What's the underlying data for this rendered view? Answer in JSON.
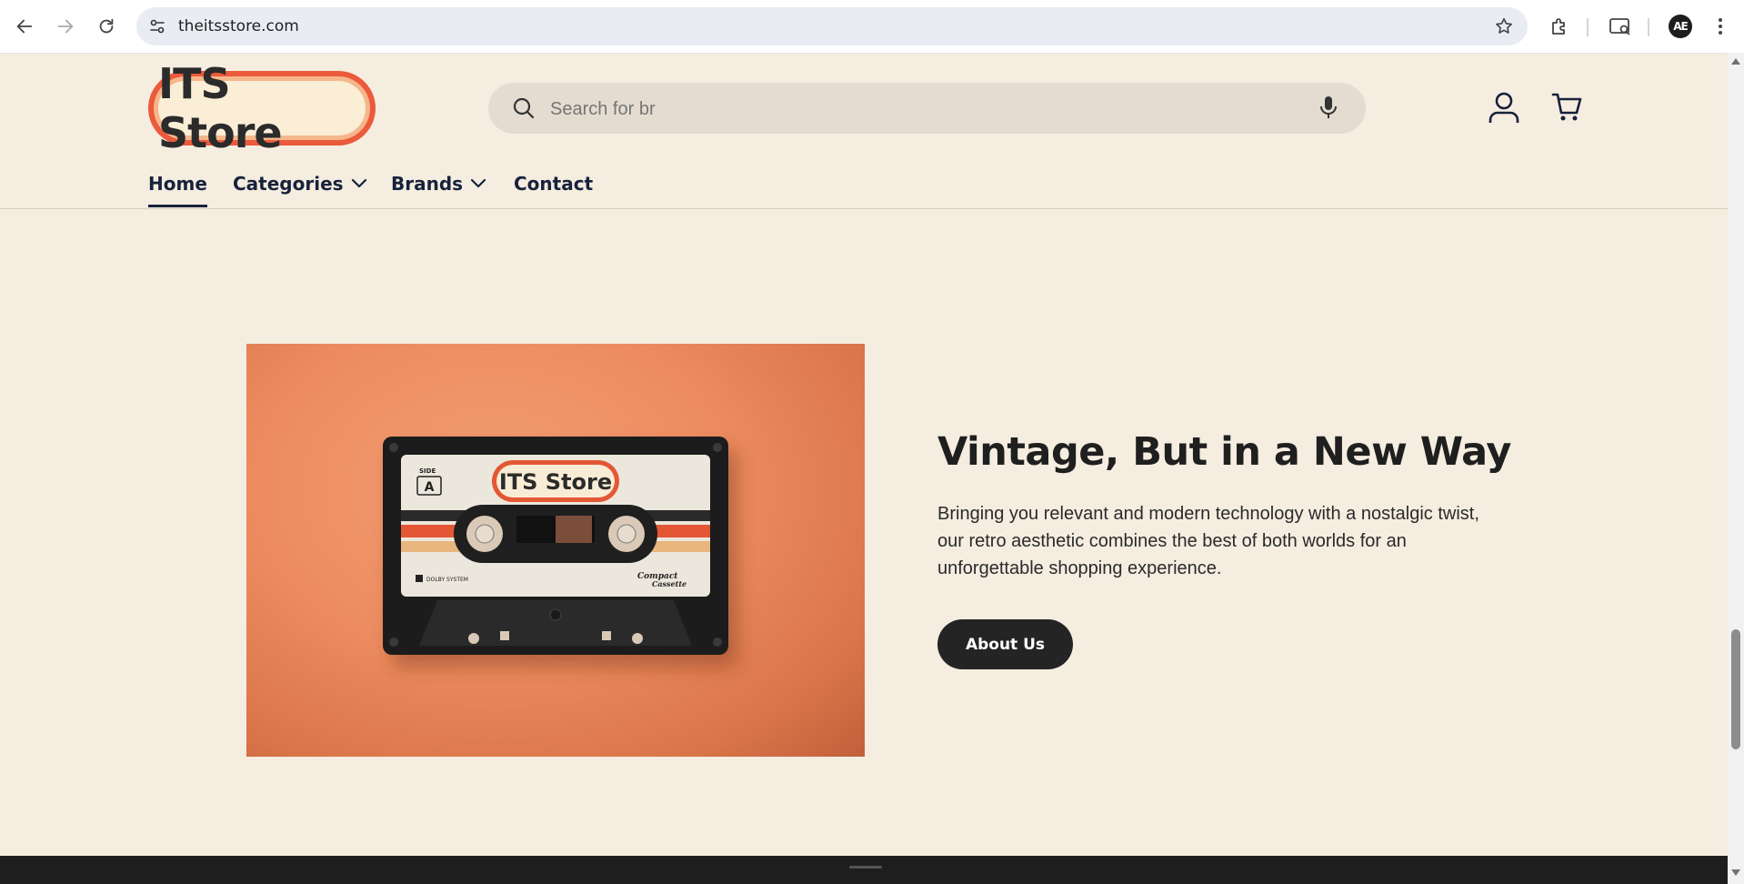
{
  "browser": {
    "url": "theitsstore.com",
    "profile_initials": "AE"
  },
  "header": {
    "logo_text": "ITS Store",
    "search": {
      "value": "",
      "placeholder": "Search for br"
    },
    "icons": [
      "account-icon",
      "cart-icon"
    ]
  },
  "nav": {
    "items": [
      {
        "label": "Home",
        "active": true
      },
      {
        "label": "Categories",
        "dropdown": true
      },
      {
        "label": "Brands",
        "dropdown": true
      },
      {
        "label": "Contact"
      }
    ]
  },
  "hero": {
    "title": "Vintage, But in a New Way",
    "text": "Bringing you relevant and modern technology with a nostalgic twist, our retro aesthetic combines the best of both worlds for an unforgettable shopping experience.",
    "button_label": "About Us",
    "cassette": {
      "label_text": "ITS Store",
      "side_label": "SIDE",
      "side_letter": "A",
      "dolby_text": "DOLBY SYSTEM",
      "brand_text_1": "Compact",
      "brand_text_2": "Cassette"
    }
  },
  "colors": {
    "page_bg": "#f5ede0",
    "accent": "#ea5a3b",
    "nav_text": "#17223b",
    "button_bg": "#242424"
  }
}
